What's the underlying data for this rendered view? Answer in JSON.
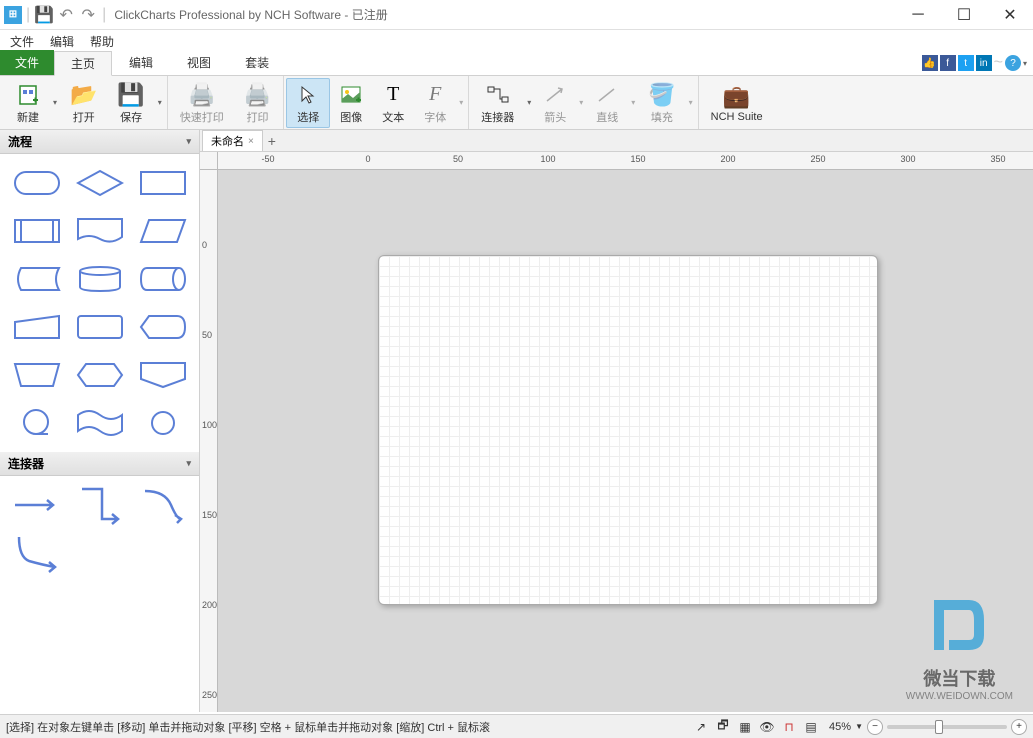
{
  "titlebar": {
    "app_title": "ClickCharts Professional by NCH Software - 已注册"
  },
  "menubar": {
    "items": [
      "文件",
      "编辑",
      "帮助"
    ]
  },
  "ribbon_tabs": {
    "file": "文件",
    "tabs": [
      "主页",
      "编辑",
      "视图",
      "套装"
    ],
    "active_index": 0
  },
  "ribbon": {
    "new": "新建",
    "open": "打开",
    "save": "保存",
    "quick_print": "快速打印",
    "print": "打印",
    "select": "选择",
    "image": "图像",
    "text": "文本",
    "font": "字体",
    "connector": "连接器",
    "arrow": "箭头",
    "line": "直线",
    "fill": "填充",
    "nch_suite": "NCH Suite"
  },
  "document_tabs": {
    "untitled": "未命名"
  },
  "sidebar": {
    "flow_header": "流程",
    "connectors_header": "连接器"
  },
  "ruler": {
    "h_ticks": [
      "-50",
      "0",
      "50",
      "100",
      "150",
      "200",
      "250",
      "300",
      "350"
    ],
    "v_ticks": [
      "0",
      "50",
      "100",
      "150",
      "200",
      "250"
    ]
  },
  "statusbar": {
    "hint": "[选择] 在对象左键单击 [移动] 单击并拖动对象 [平移] 空格 + 鼠标单击并拖动对象 [缩放] Ctrl + 鼠标滚",
    "zoom_label": "45%",
    "zoom_dd": "▼"
  },
  "watermark": {
    "text": "微当下载",
    "url": "WWW.WEIDOWN.COM"
  }
}
